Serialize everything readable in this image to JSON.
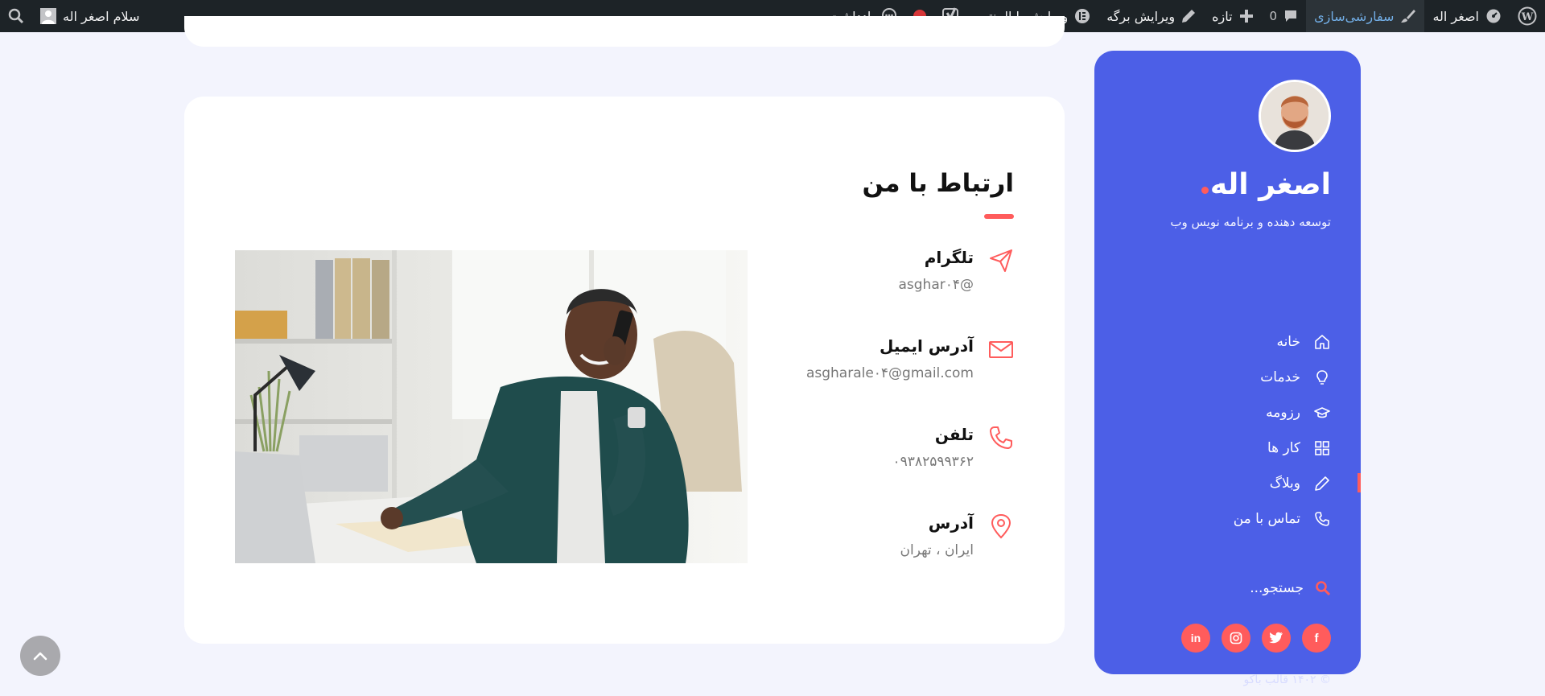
{
  "adminbar": {
    "site_name": "اصغر اله",
    "customize": "سفارشی‌سازی",
    "comments_count": "0",
    "new_label": "تازه",
    "edit_page": "ویرایش برگه",
    "edit_elementor": "ویرایش با المنتور",
    "notes": "یادداشت",
    "greeting": "سلام اصغر اله"
  },
  "sidebar": {
    "name": "اصغر اله",
    "role": "توسعه دهنده و برنامه نویس وب",
    "menu": [
      {
        "label": "خانه",
        "icon": "home-icon"
      },
      {
        "label": "خدمات",
        "icon": "lightbulb-icon"
      },
      {
        "label": "رزومه",
        "icon": "graduation-cap-icon"
      },
      {
        "label": "کار ها",
        "icon": "grid-icon"
      },
      {
        "label": "وبلاگ",
        "icon": "pencil-icon"
      },
      {
        "label": "تماس با من",
        "icon": "phone-icon"
      }
    ],
    "search_placeholder": "جستجو...",
    "social": [
      "facebook-icon",
      "twitter-icon",
      "instagram-icon",
      "linkedin-icon"
    ],
    "copyright": "© ۱۴۰۲ قالب باکو"
  },
  "contact": {
    "title": "ارتباط با من",
    "items": [
      {
        "label": "تلگرام",
        "value": "@asghar۰۴",
        "icon": "telegram-icon"
      },
      {
        "label": "آدرس ایمیل",
        "value": "asgharale۰۴@gmail.com",
        "icon": "mail-icon"
      },
      {
        "label": "تلفن",
        "value": "۰۹۳۸۲۵۹۹۳۶۲",
        "icon": "phone-icon"
      },
      {
        "label": "آدرس",
        "value": "ایران ، تهران",
        "icon": "location-pin-icon"
      }
    ]
  },
  "colors": {
    "accent": "#ff5c5c",
    "sidebar_bg": "#4c5fe7",
    "page_bg": "#f3f4fd",
    "adminbar_bg": "#1d2327"
  }
}
